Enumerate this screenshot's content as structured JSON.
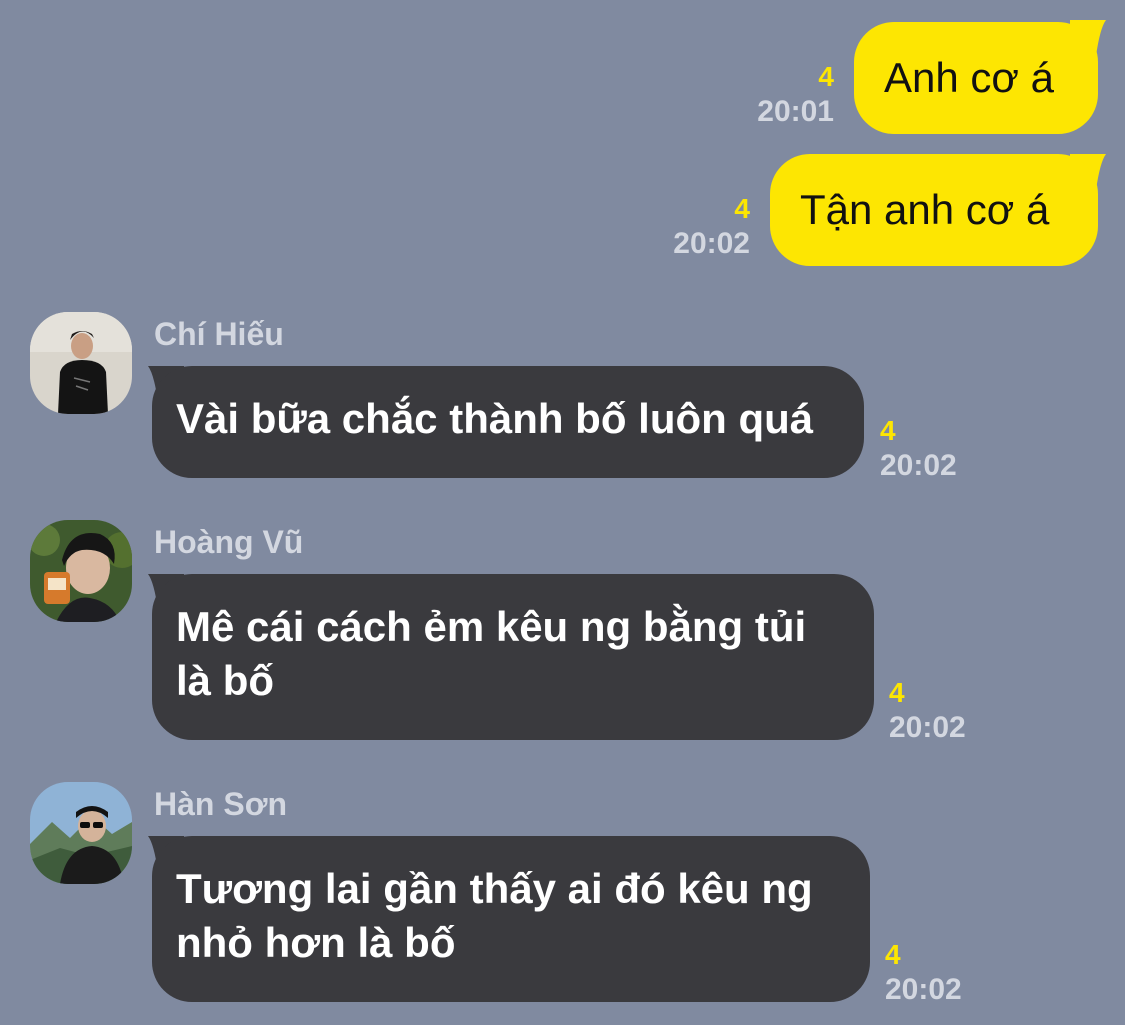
{
  "theme": {
    "background": "#808aa0",
    "outgoing_bubble": "#fde602",
    "incoming_bubble": "#3a3a3e",
    "unread_color": "#fde602",
    "meta_text": "#d3d7e0"
  },
  "outgoing": [
    {
      "text": "Anh cơ á",
      "unread": "4",
      "time": "20:01"
    },
    {
      "text": "Tận anh cơ á",
      "unread": "4",
      "time": "20:02"
    }
  ],
  "incoming": [
    {
      "sender": "Chí Hiếu",
      "avatar_icon": "person-black-shirt-avatar-icon",
      "text": "Vài bữa chắc thành bố luôn quá",
      "unread": "4",
      "time": "20:02"
    },
    {
      "sender": "Hoàng Vũ",
      "avatar_icon": "person-with-camera-avatar-icon",
      "text": "Mê cái cách ẻm kêu ng bằng tủi là bố",
      "unread": "4",
      "time": "20:02"
    },
    {
      "sender": "Hàn Sơn",
      "avatar_icon": "person-sunglasses-mountains-avatar-icon",
      "text": "Tương lai gần thấy ai đó kêu ng nhỏ hơn là bố",
      "unread": "4",
      "time": "20:02"
    }
  ]
}
